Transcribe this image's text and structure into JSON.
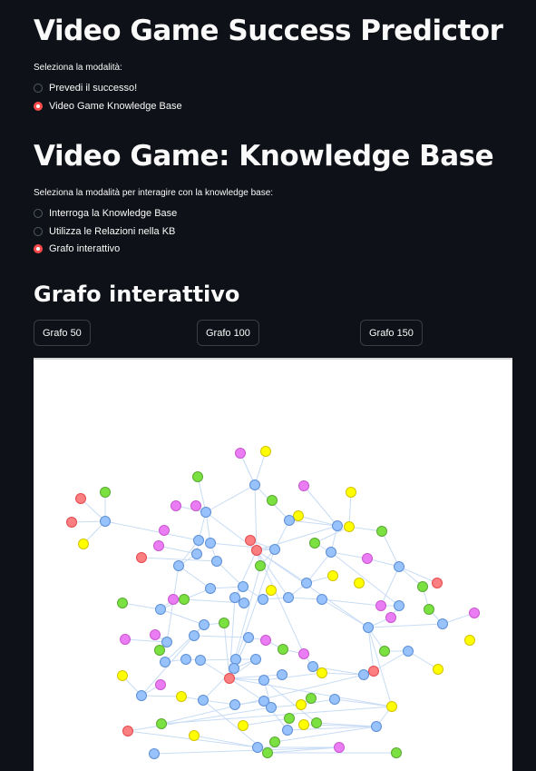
{
  "app_title": "Video Game Success Predictor",
  "mode_selector": {
    "label": "Seleziona la modalità:",
    "options": [
      "Prevedi il successo!",
      "Video Game Knowledge Base"
    ],
    "selected_index": 1
  },
  "kb_section": {
    "title": "Video Game: Knowledge Base",
    "mode_label": "Seleziona la modalità per interagire con la knowledge base:",
    "options": [
      "Interroga la Knowledge Base",
      "Utilizza le Relazioni nella KB",
      "Grafo interattivo"
    ],
    "selected_index": 2
  },
  "graph_section": {
    "title": "Grafo interattivo",
    "buttons": [
      "Grafo 50",
      "Grafo 100",
      "Grafo 150"
    ]
  },
  "colors": {
    "background": "#0e1117",
    "accent": "#ff4b4b",
    "node_blue": "#97c2fc",
    "node_blue_border": "#5d8fd6",
    "node_green": "#7be141",
    "node_green_border": "#5aa832",
    "node_pink": "#eb7df4",
    "node_pink_border": "#c855d0",
    "node_yellow": "#ffff00",
    "node_yellow_border": "#d4c200",
    "node_red": "#fb7e81",
    "node_red_border": "#e24a4e",
    "edge": "#c8dcf5"
  }
}
